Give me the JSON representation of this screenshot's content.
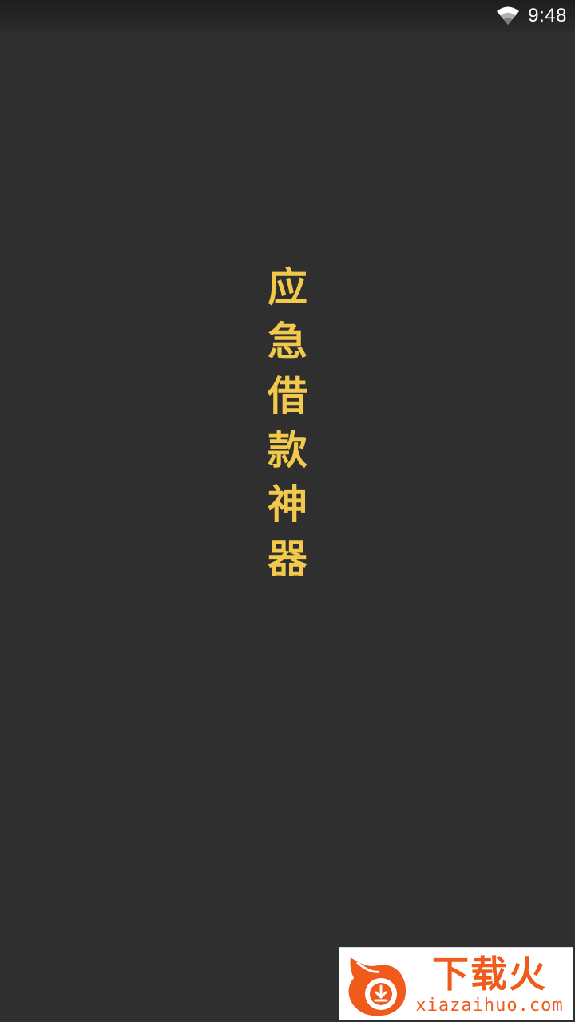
{
  "status_bar": {
    "time": "9:48",
    "wifi_icon": "wifi-icon"
  },
  "splash": {
    "title_chars": [
      "应",
      "急",
      "借",
      "款",
      "神",
      "器"
    ],
    "title_color": "#f2c94a",
    "background": "#2f2f2f"
  },
  "watermark": {
    "logo_icon": "flame-download-icon",
    "title": "下载火",
    "subtitle": "xiazaihuo.com",
    "color": "#f05a1a"
  }
}
